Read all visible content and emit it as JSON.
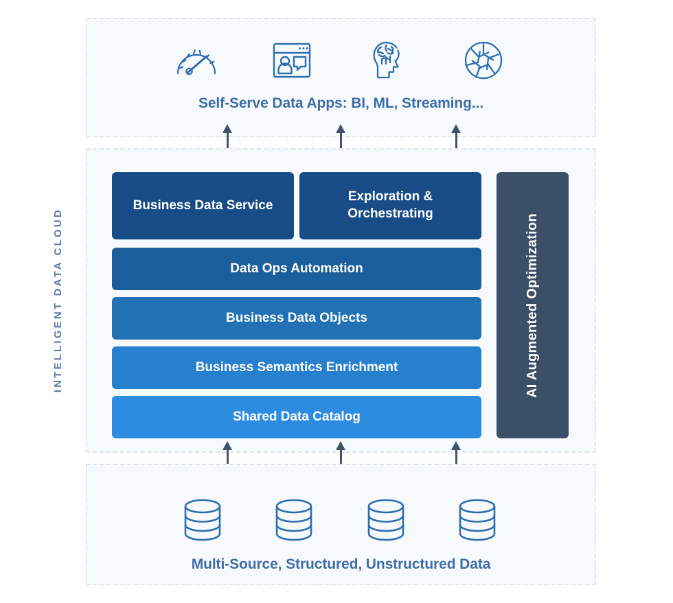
{
  "theme": {
    "background": "#ffffff",
    "panel_fill": "#f7fafd",
    "panel_border": "#dde5ee",
    "caption_color": "#3d6da8",
    "icon_stroke": "#2e6eb0",
    "arrow_color": "#41536b",
    "side_label_color": "#5a7ba6",
    "ai_block_color": "#3b4f66"
  },
  "side_label": {
    "text": "INTELLIGENT DATA CLOUD"
  },
  "apps_layer": {
    "caption": "Self-Serve Data Apps: BI, ML, Streaming...",
    "icons": [
      {
        "name": "gauge-icon",
        "label": "Gauge"
      },
      {
        "name": "browser-window-user-chat-icon",
        "label": "Browser Window with User and Chat"
      },
      {
        "name": "brain-head-icon",
        "label": "Head with Brain"
      },
      {
        "name": "aperture-icon",
        "label": "Camera Aperture"
      }
    ]
  },
  "core_layer": {
    "blocks": [
      {
        "id": "business-data-service",
        "label": "Business Data Service",
        "color": "#174c87"
      },
      {
        "id": "exploration-orchestrating",
        "label": "Exploration & Orchestrating",
        "color": "#174c87"
      },
      {
        "id": "data-ops-automation",
        "label": "Data Ops Automation",
        "color": "#1b5e9c"
      },
      {
        "id": "business-data-objects",
        "label": "Business Data Objects",
        "color": "#2171b4"
      },
      {
        "id": "business-semantics-enrichment",
        "label": "Business Semantics Enrichment",
        "color": "#2680cd"
      },
      {
        "id": "shared-data-catalog",
        "label": "Shared Data Catalog",
        "color": "#2e8ce0"
      }
    ],
    "sidebar_block": {
      "id": "ai-augmented-optimization",
      "label": "AI Augmented Optimization",
      "color": "#3b4f66"
    }
  },
  "source_layer": {
    "caption": "Multi-Source, Structured, Unstructured Data",
    "icons": [
      {
        "name": "database-cylinder-icon",
        "label": "Database"
      },
      {
        "name": "database-cylinder-icon",
        "label": "Database"
      },
      {
        "name": "database-cylinder-icon",
        "label": "Database"
      },
      {
        "name": "database-cylinder-icon",
        "label": "Database"
      }
    ]
  },
  "arrows": {
    "upper_count": 3,
    "lower_count": 3,
    "direction": "up"
  }
}
